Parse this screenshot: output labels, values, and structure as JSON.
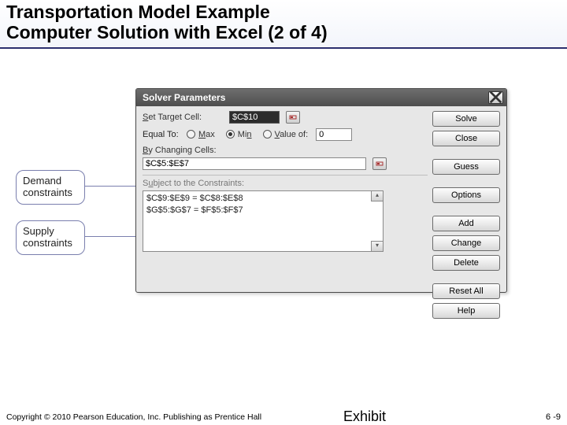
{
  "slide": {
    "title_line1": "Transportation Model Example",
    "title_line2": "Computer Solution with Excel (2 of 4)",
    "copyright": "Copyright © 2010 Pearson Education, Inc. Publishing as Prentice Hall",
    "exhibit_label": "Exhibit",
    "page_number": "6 -9"
  },
  "callouts": {
    "demand": "Demand constraints",
    "supply": "Supply constraints"
  },
  "dialog": {
    "title": "Solver Parameters",
    "labels": {
      "set_target": "Set Target Cell:",
      "equal_to": "Equal To:",
      "max": "Max",
      "min": "Min",
      "value_of": "Value of:",
      "by_changing": "By Changing Cells:",
      "subject_to": "Subject to the Constraints:"
    },
    "values": {
      "target_cell": "$C$10",
      "value_of": "0",
      "changing_cells": "$C$5:$E$7",
      "radio_selected": "min"
    },
    "constraints": [
      "$C$9:$E$9 = $C$8:$E$8",
      "$G$5:$G$7 = $F$5:$F$7"
    ],
    "buttons": {
      "solve": "Solve",
      "close": "Close",
      "guess": "Guess",
      "options": "Options",
      "add": "Add",
      "change": "Change",
      "delete": "Delete",
      "reset_all": "Reset All",
      "help": "Help"
    }
  }
}
